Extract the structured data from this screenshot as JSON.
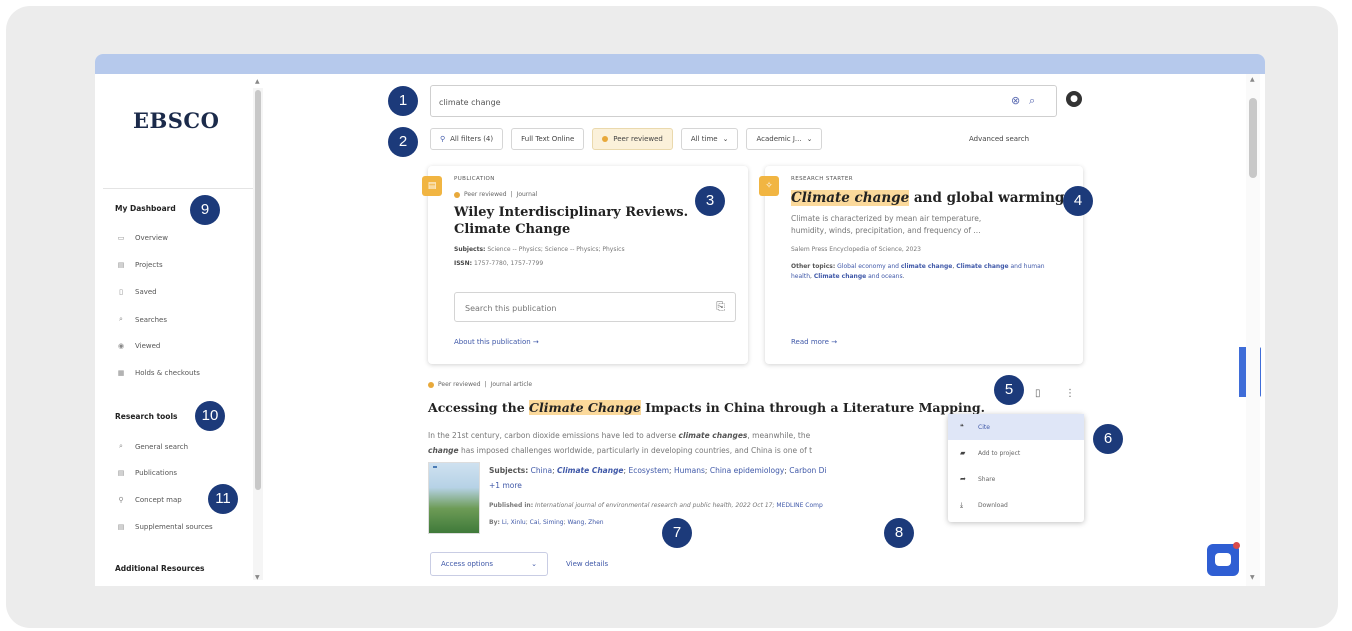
{
  "logo": "EBSCO",
  "search": {
    "value": "climate change"
  },
  "filters": {
    "all_filters": "All filters (4)",
    "full_text": "Full Text Online",
    "peer": "Peer reviewed",
    "time": "All time",
    "type": "Academic J...",
    "advanced": "Advanced search"
  },
  "sidebar": {
    "dashboard_head": "My Dashboard",
    "dashboard_items": [
      "Overview",
      "Projects",
      "Saved",
      "Searches",
      "Viewed",
      "Holds & checkouts"
    ],
    "research_head": "Research tools",
    "research_items": [
      "General search",
      "Publications",
      "Concept map",
      "Supplemental sources"
    ],
    "additional_head": "Additional Resources"
  },
  "pub_card": {
    "type": "PUBLICATION",
    "peer": "Peer reviewed",
    "kind": "Journal",
    "title_line1": "Wiley Interdisciplinary Reviews.",
    "title_line2": "Climate Change",
    "subjects_label": "Subjects:",
    "subjects": "Science -- Physics; Science -- Physics; Physics",
    "issn_label": "ISSN:",
    "issn": "1757-7780, 1757-7799",
    "search_placeholder": "Search this publication",
    "about": "About this publication"
  },
  "topic_card": {
    "type": "RESEARCH STARTER",
    "title_hl": "Climate change",
    "title_rest": " and global warming.",
    "desc_line1": "Climate is characterized by mean air temperature,",
    "desc_line2": "humidity, winds, precipitation, and frequency of ...",
    "source": "Salem Press Encyclopedia of Science, 2023",
    "other_label": "Other topics:",
    "other_1": "Global economy and",
    "other_1b": "climate change",
    "other_2": "Climate change",
    "other_2b": "and human health",
    "other_3": "Climate change",
    "other_3b": "and oceans",
    "read_more": "Read more"
  },
  "result": {
    "peer": "Peer reviewed",
    "kind": "Journal article",
    "title_a": "Accessing the ",
    "title_hl": "Climate Change",
    "title_b": " Impacts in China through a Literature Mapping.",
    "abs_a": "In the 21st century, carbon dioxide emissions have led to adverse ",
    "abs_hl1": "climate changes",
    "abs_b": ", meanwhile, the",
    "abs_hl2": "change",
    "abs_c": " has imposed challenges worldwide, particularly in developing countries, and China is one of t",
    "subjects_label": "Subjects:",
    "subjects": [
      "China",
      "Climate Change",
      "Ecosystem",
      "Humans",
      "China epidemiology",
      "Carbon Di"
    ],
    "more": "+1 more",
    "published_label": "Published in:",
    "published": "International journal of environmental research and public health, 2022 Oct 17;",
    "published_tail": "MEDLINE Comp",
    "by_label": "By:",
    "authors": [
      "Li, Xinlu",
      "Cai, Siming",
      "Wang, Zhen"
    ],
    "access": "Access options",
    "view_details": "View details"
  },
  "menu": {
    "items": [
      "Cite",
      "Add to project",
      "Share",
      "Download"
    ]
  },
  "feedback": "Feedback",
  "markers": [
    "1",
    "2",
    "3",
    "4",
    "5",
    "6",
    "7",
    "8",
    "9",
    "10",
    "11"
  ]
}
